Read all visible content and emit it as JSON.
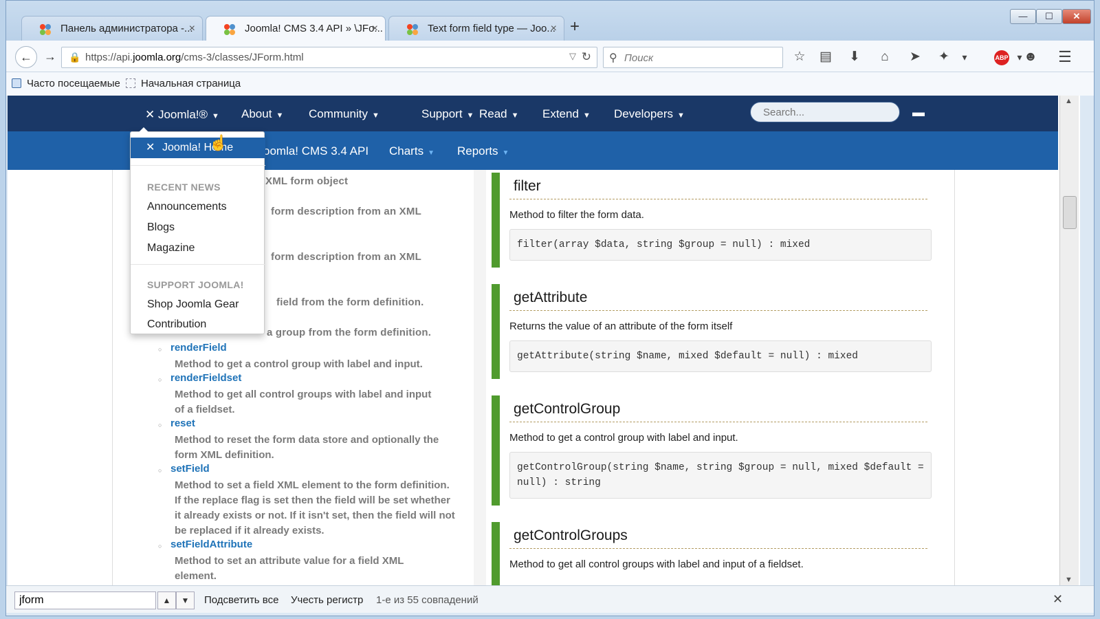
{
  "browser": {
    "tabs": [
      {
        "title": "Панель администратора -...",
        "close": "×"
      },
      {
        "title": "Joomla! CMS 3.4 API » \\JFo...",
        "close": "×"
      },
      {
        "title": "Text form field type — Joo...",
        "close": "×"
      }
    ],
    "new_tab": "+",
    "window_buttons": {
      "minimize": "—",
      "maximize": "☐",
      "close": "✕"
    },
    "url_prefix": "https://api.",
    "url_domain": "joomla.org",
    "url_path": "/cms-3/classes/JForm.html",
    "search_placeholder": "Поиск",
    "icons": {
      "back": "←",
      "forward": "→",
      "lock": "🔒",
      "reload": "↻",
      "dropdown": "▽",
      "search": "⚲",
      "star": "☆",
      "reading_list": "▤",
      "download": "⬇",
      "home": "⌂",
      "send": "➤",
      "extension": "✦",
      "dropdown_arrow": "▾",
      "abp": "ABP",
      "chat": "☻",
      "menu": "☰"
    },
    "bookmarks": [
      "Часто посещаемые",
      "Начальная страница"
    ]
  },
  "site": {
    "top_nav": [
      {
        "label": "Joomla!®",
        "icon": "joomla-icon"
      },
      {
        "label": "About"
      },
      {
        "label": "Community"
      },
      {
        "label": "Support"
      },
      {
        "label": "Read"
      },
      {
        "label": "Extend"
      },
      {
        "label": "Developers"
      }
    ],
    "caret": "▼",
    "search_placeholder": "Search...",
    "chat_icon": "▬",
    "sub_nav": [
      {
        "label": "oomla! CMS 3.4 API"
      },
      {
        "label": "Charts"
      },
      {
        "label": "Reports"
      }
    ],
    "sub_caret": "▼"
  },
  "dropdown": {
    "home_label": "Joomla! Home",
    "home_icon": "✕",
    "sections": [
      {
        "header": "RECENT NEWS",
        "items": [
          "Announcements",
          "Blogs",
          "Magazine"
        ]
      },
      {
        "header": "SUPPORT JOOMLA!",
        "items": [
          "Shop Joomla Gear",
          "Contribution"
        ]
      }
    ],
    "cursor": "☝"
  },
  "left_panel": {
    "partial_lines": [
      "XML form object",
      "form description from an XML",
      "form description from an XML",
      "field from the form definition.",
      "a group from the form definition."
    ],
    "methods": [
      {
        "name": "renderField",
        "desc": "Method to get a control group with label and input."
      },
      {
        "name": "renderFieldset",
        "desc": "Method to get all control groups with label and input of a fieldset."
      },
      {
        "name": "reset",
        "desc": "Method to reset the form data store and optionally the form XML definition."
      },
      {
        "name": "setField",
        "desc": "Method to set a field XML element to the form definition. If the replace flag is set then the field will be set whether it already exists or not. If it isn't set, then the field will not be replaced if it already exists."
      },
      {
        "name": "setFieldAttribute",
        "desc": "Method to set an attribute value for a field XML element."
      }
    ],
    "bullet": "○"
  },
  "right_panel": {
    "methods": [
      {
        "name": "filter",
        "desc": "Method to filter the form data.",
        "signature": "filter(array $data, string $group = null) : mixed"
      },
      {
        "name": "getAttribute",
        "desc": "Returns the value of an attribute of the form itself",
        "signature": "getAttribute(string $name, mixed $default = null) : mixed"
      },
      {
        "name": "getControlGroup",
        "desc": "Method to get a control group with label and input.",
        "signature": "getControlGroup(string $name, string $group = null, mixed $default = null) : string"
      },
      {
        "name": "getControlGroups",
        "desc": "Method to get all control groups with label and input of a fieldset.",
        "signature": ""
      }
    ]
  },
  "scrollbar": {
    "up": "▲",
    "down": "▼"
  },
  "findbar": {
    "query": "jform",
    "prev": "▲",
    "next": "▼",
    "highlight_all": "Подсветить все",
    "match_case": "Учесть регистр",
    "status": "1-е из 55 совпадений",
    "close": "✕"
  }
}
